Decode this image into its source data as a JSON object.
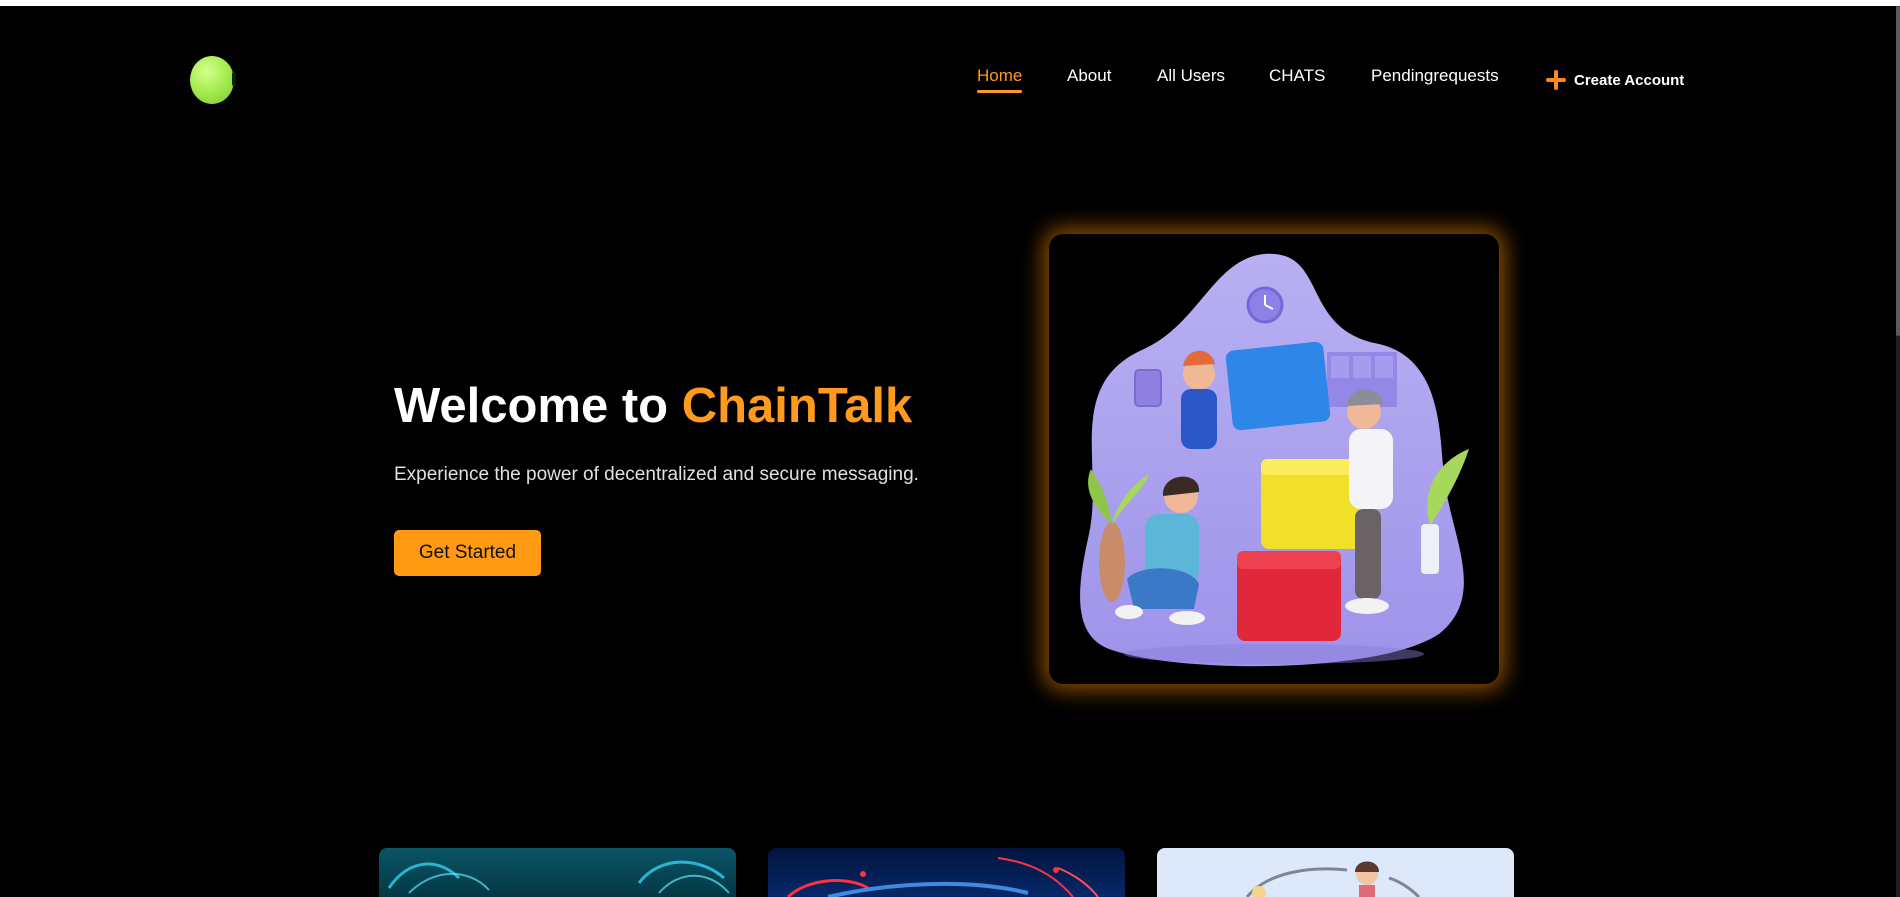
{
  "nav": {
    "items": [
      {
        "label": "Home",
        "active": true
      },
      {
        "label": "About",
        "active": false
      },
      {
        "label": "All Users",
        "active": false
      },
      {
        "label": "CHATS",
        "active": false
      },
      {
        "label": "Pendingrequests",
        "active": false
      }
    ],
    "create_account": "Create Account"
  },
  "hero": {
    "title_prefix": "Welcome to ",
    "title_brand": "ChainTalk",
    "subtitle": "Experience the power of decentralized and secure messaging.",
    "cta": "Get Started"
  },
  "colors": {
    "background": "#000000",
    "accent": "#ff9a1e",
    "logo": "#a7ee52"
  },
  "icons": {
    "create_account": "plus-icon",
    "logo": "green-orb-logo"
  }
}
